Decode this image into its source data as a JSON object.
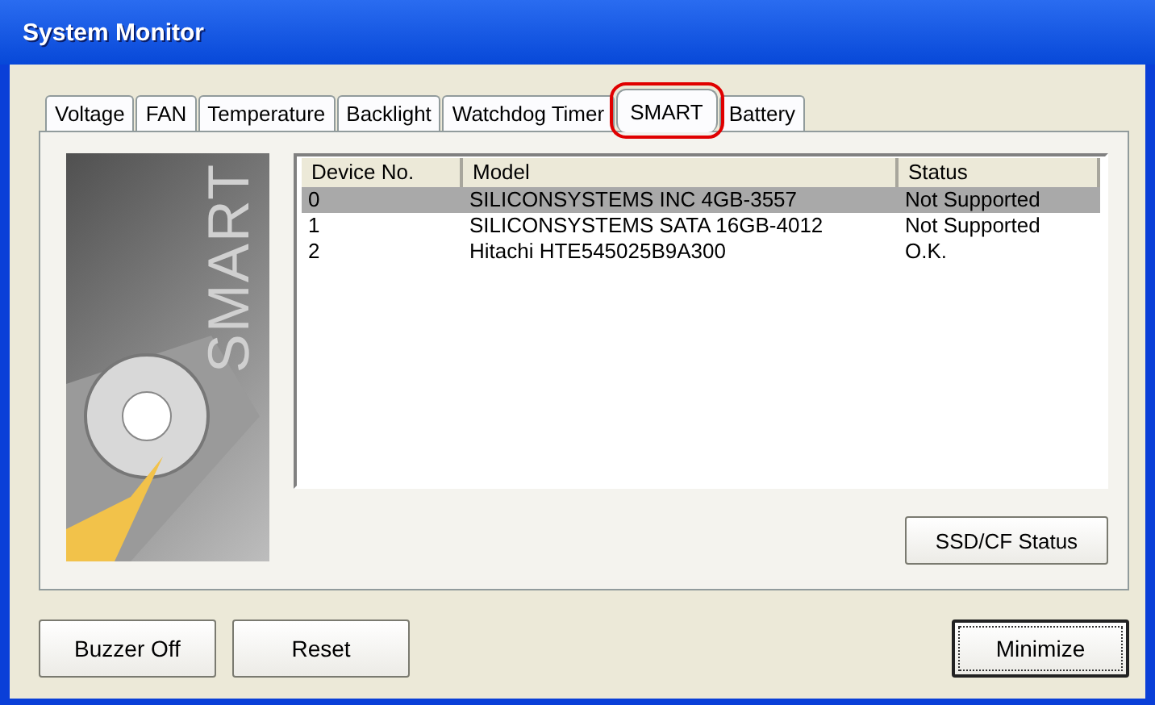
{
  "window": {
    "title": "System Monitor"
  },
  "tabs": [
    {
      "label": "Voltage",
      "selected": false,
      "highlighted": false
    },
    {
      "label": "FAN",
      "selected": false,
      "highlighted": false
    },
    {
      "label": "Temperature",
      "selected": false,
      "highlighted": false
    },
    {
      "label": "Backlight",
      "selected": false,
      "highlighted": false
    },
    {
      "label": "Watchdog Timer",
      "selected": false,
      "highlighted": false
    },
    {
      "label": "SMART",
      "selected": true,
      "highlighted": true
    },
    {
      "label": "Battery",
      "selected": false,
      "highlighted": false
    }
  ],
  "side_image": {
    "text": "SMART"
  },
  "table": {
    "columns": [
      "Device No.",
      "Model",
      "Status"
    ],
    "rows": [
      {
        "cells": [
          "0",
          "SILICONSYSTEMS INC 4GB-3557",
          "Not Supported"
        ],
        "selected": true
      },
      {
        "cells": [
          "1",
          "SILICONSYSTEMS SATA 16GB-4012",
          "Not Supported"
        ],
        "selected": false
      },
      {
        "cells": [
          "2",
          "Hitachi HTE545025B9A300",
          "O.K."
        ],
        "selected": false
      }
    ]
  },
  "panel_button": "SSD/CF Status",
  "buttons": [
    {
      "label": "Buzzer Off",
      "default": false
    },
    {
      "label": "Reset",
      "default": false
    },
    {
      "label": "Minimize",
      "default": true
    }
  ]
}
